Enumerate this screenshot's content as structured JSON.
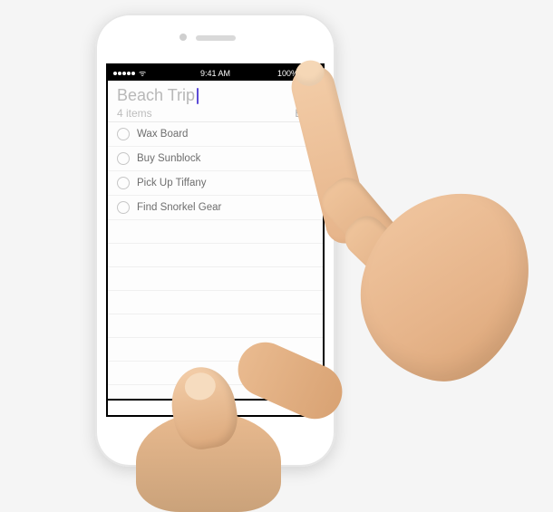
{
  "status_bar": {
    "carrier_dots": 5,
    "wifi": "▾",
    "time": "9:41 AM",
    "battery_pct": "100%"
  },
  "header": {
    "title": "Beach Trip",
    "item_count_label": "4 items",
    "edit_label": "Edit"
  },
  "list": {
    "items": [
      {
        "label": "Wax Board",
        "done": false
      },
      {
        "label": "Buy Sunblock",
        "done": false
      },
      {
        "label": "Pick Up Tiffany",
        "done": false
      },
      {
        "label": "Find Snorkel Gear",
        "done": false
      }
    ]
  }
}
